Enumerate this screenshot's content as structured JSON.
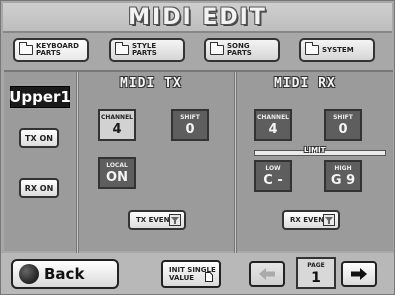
{
  "window": {
    "title": "MIDI EDIT"
  },
  "tabs": [
    {
      "label_line1": "KEYBOARD",
      "label_line2": "PARTS",
      "active": true
    },
    {
      "label_line1": "STYLE",
      "label_line2": "PARTS",
      "active": false
    },
    {
      "label_line1": "SONG",
      "label_line2": "PARTS",
      "active": false
    },
    {
      "label_line1": "SYSTEM",
      "label_line2": "",
      "active": false
    }
  ],
  "part": {
    "name": "Upper1",
    "tx_button": "TX ON",
    "rx_button": "RX ON"
  },
  "tx": {
    "title": "MIDI TX",
    "channel": {
      "label": "CHANNEL",
      "value": "4"
    },
    "shift": {
      "label": "SHIFT",
      "value": "0"
    },
    "local": {
      "label": "LOCAL",
      "value": "ON"
    },
    "event_button": "TX EVENT"
  },
  "rx": {
    "title": "MIDI RX",
    "channel": {
      "label": "CHANNEL",
      "value": "4"
    },
    "shift": {
      "label": "SHIFT",
      "value": "0"
    },
    "limit_label": "LIMIT",
    "low": {
      "label": "LOW",
      "value": "C -"
    },
    "high": {
      "label": "HIGH",
      "value": "G 9"
    },
    "event_button": "RX EVENT"
  },
  "bottom": {
    "back_label": "Back",
    "init_line1": "INIT SINGLE",
    "init_line2": "VALUE",
    "page_label": "PAGE",
    "page_value": "1",
    "prev_arrow": "🡸",
    "next_arrow": "🡺"
  },
  "icons": {
    "folder": "folder-icon",
    "funnel": "filter-icon",
    "globe": "globe-icon",
    "arrow_left": "arrow-left-icon",
    "arrow_right": "arrow-right-icon"
  }
}
